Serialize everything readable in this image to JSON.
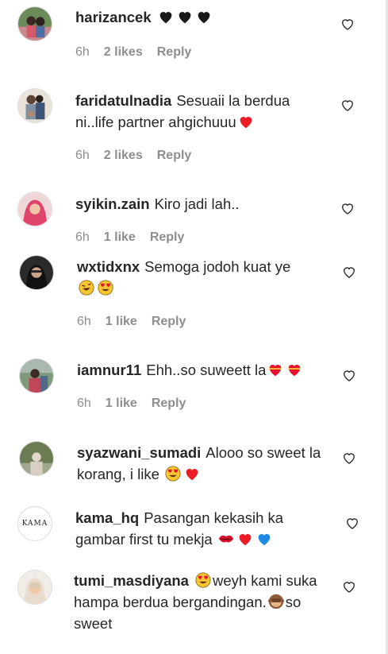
{
  "comments": [
    {
      "username": "harizancek",
      "text": "",
      "time": "6h",
      "likes": "2 likes",
      "reply": "Reply"
    },
    {
      "username": "faridatulnadia",
      "text": "Sesuaii la berdua ni..life partner ahgichuuu",
      "time": "6h",
      "likes": "2 likes",
      "reply": "Reply"
    },
    {
      "username": "syikin.zain",
      "text": "Kiro jadi lah..",
      "time": "6h",
      "likes": "1 like",
      "reply": "Reply"
    },
    {
      "username": "wxtidxnx",
      "text": "Semoga jodoh kuat ye",
      "time": "6h",
      "likes": "1 like",
      "reply": "Reply"
    },
    {
      "username": "iamnur11",
      "text": "Ehh..so suweett la",
      "time": "6h",
      "likes": "1 like",
      "reply": "Reply"
    },
    {
      "username": "syazwani_sumadi",
      "text": "Alooo so sweet la korang, i like",
      "time": "",
      "likes": "",
      "reply": ""
    },
    {
      "username": "kama_hq",
      "text": "Pasangan kekasih ka gambar first tu mekja",
      "time": "",
      "likes": "",
      "reply": "",
      "avatar_text": "KAMA"
    },
    {
      "username": "tumi_masdiyana",
      "text_a": "weyh kami suka hampa berdua bergandingan.",
      "text_b": "so sweet",
      "time": "",
      "likes": "",
      "reply": ""
    }
  ],
  "colors": {
    "text": "#262626",
    "meta": "#8e8e8e",
    "heart_red": "#ed1c24",
    "heart_blue": "#1e88e5"
  }
}
